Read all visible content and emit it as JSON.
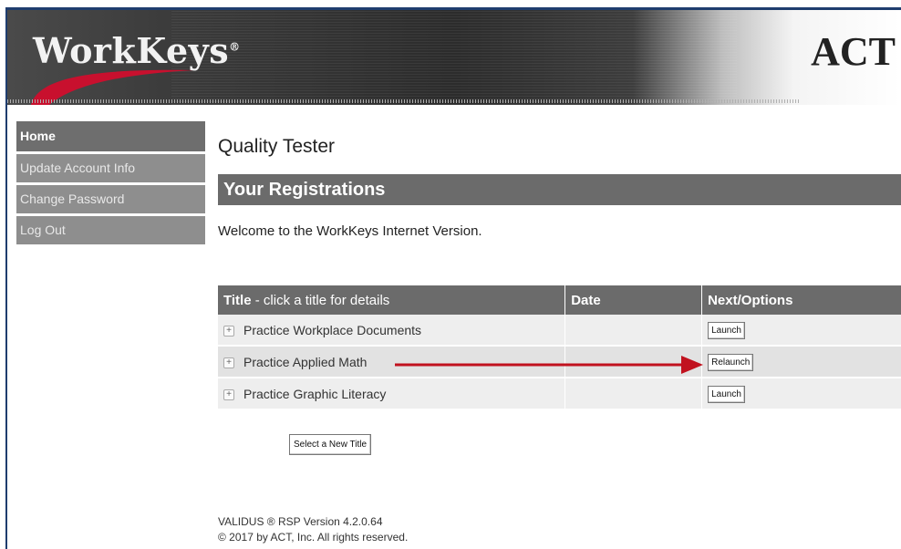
{
  "header": {
    "logo_text": "WorkKeys",
    "logo_mark": "®",
    "brand_text": "ACT"
  },
  "sidebar": {
    "items": [
      {
        "label": "Home"
      },
      {
        "label": "Update Account Info"
      },
      {
        "label": "Change Password"
      },
      {
        "label": "Log Out"
      }
    ]
  },
  "main": {
    "user_name": "Quality Tester",
    "section_title": "Your Registrations",
    "welcome": "Welcome to the WorkKeys Internet Version.",
    "table": {
      "headers": {
        "title": "Title",
        "title_note": " - click a title for details",
        "date": "Date",
        "options": "Next/Options"
      },
      "rows": [
        {
          "title": "Practice Workplace Documents",
          "date": "",
          "action": "Launch"
        },
        {
          "title": "Practice Applied Math",
          "date": "",
          "action": "Relaunch"
        },
        {
          "title": "Practice Graphic Literacy",
          "date": "",
          "action": "Launch"
        }
      ]
    },
    "select_new_title": "Select a New Title",
    "footer": {
      "version": "VALIDUS ® RSP Version 4.2.0.64",
      "copyright": "© 2017 by ACT, Inc. All rights reserved."
    }
  },
  "colors": {
    "border": "#1f3d6e",
    "bar_gray": "#6b6b6b",
    "sidebar_gray": "#8e8e8e",
    "arrow_red": "#c1121f"
  }
}
